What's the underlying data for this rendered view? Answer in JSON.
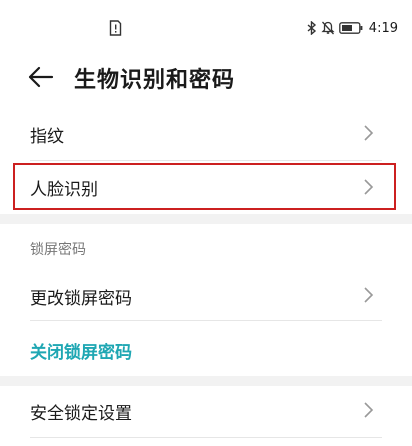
{
  "status_bar": {
    "time": "4:19",
    "icons": [
      "sim-alert-icon",
      "bluetooth-icon",
      "mute-icon",
      "battery-icon"
    ]
  },
  "header": {
    "title": "生物识别和密码",
    "back_icon": "arrow-left-icon"
  },
  "biometrics": {
    "fingerprint_label": "指纹",
    "face_label": "人脸识别"
  },
  "lock_screen": {
    "section_label": "锁屏密码",
    "change_label": "更改锁屏密码",
    "disable_label": "关闭锁屏密码"
  },
  "security": {
    "lock_settings_label": "安全锁定设置"
  },
  "colors": {
    "accent": "#1fa7b3",
    "highlight": "#cc2020",
    "divider": "#e6e6e6",
    "section_gap": "#f2f2f2",
    "secondary_text": "#777777"
  }
}
